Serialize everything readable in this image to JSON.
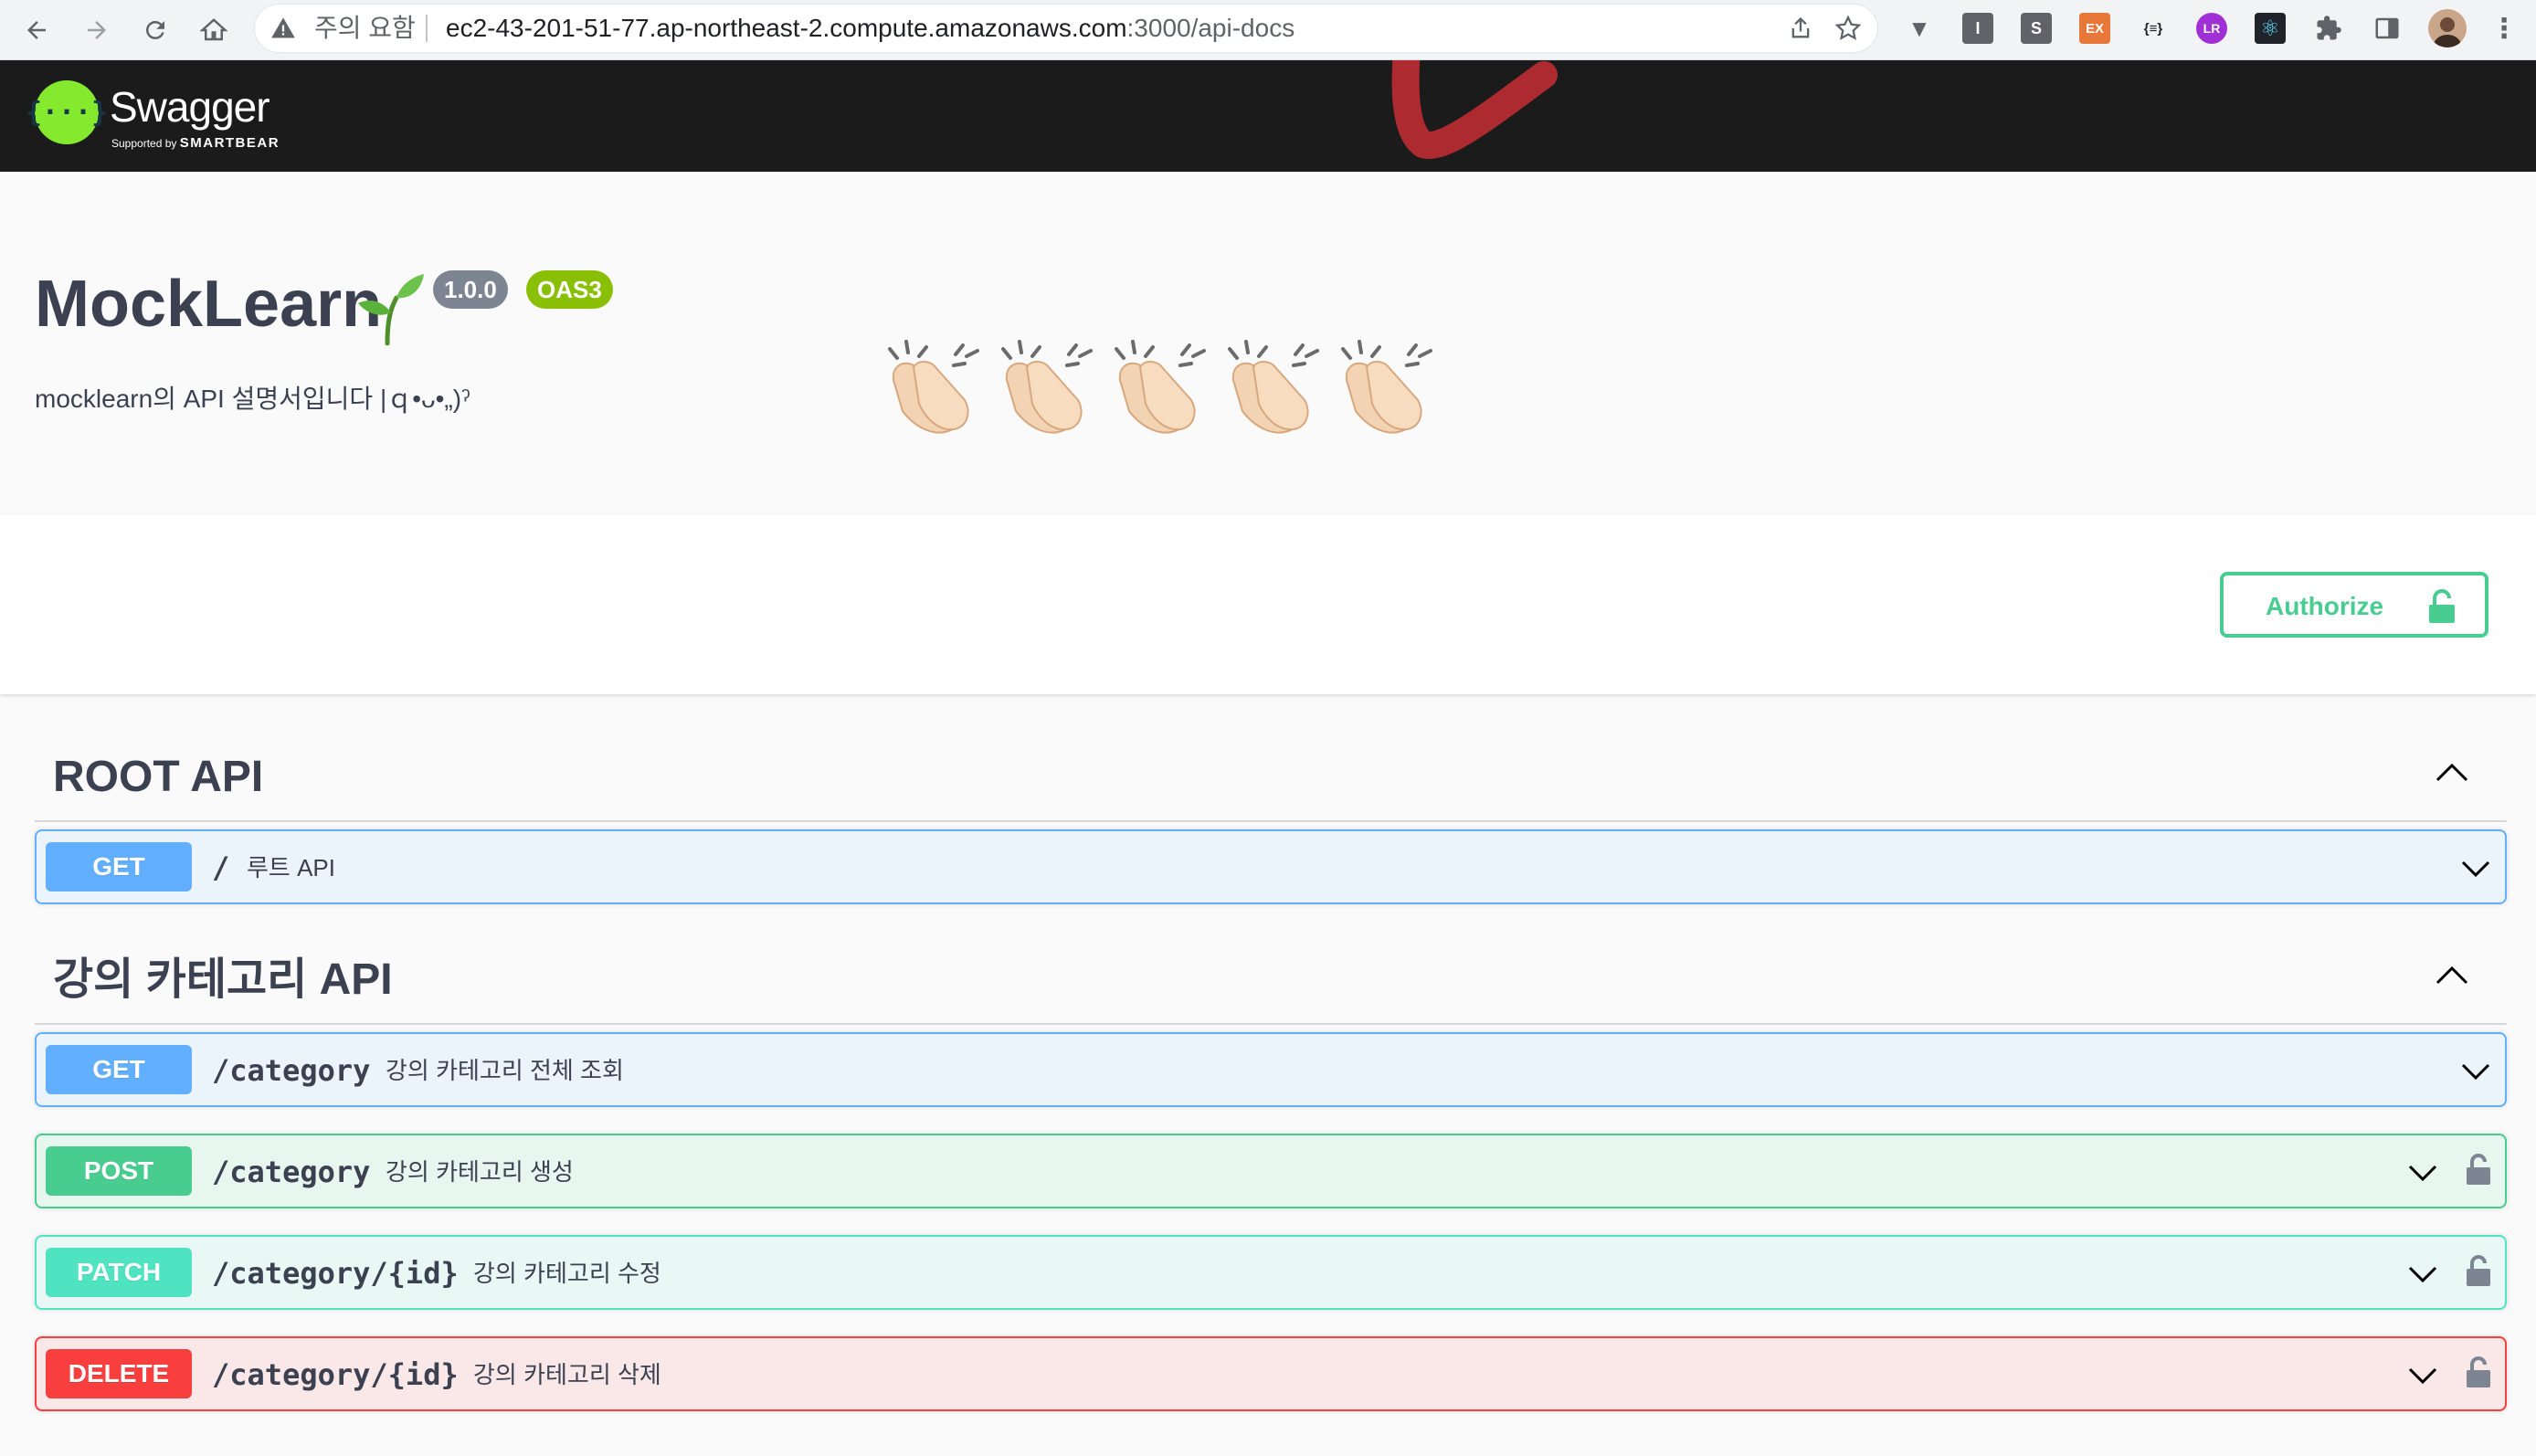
{
  "browser": {
    "security_label": "주의 요함",
    "url_host": "ec2-43-201-51-77.ap-northeast-2.compute.amazonaws.com",
    "url_rest": ":3000/api-docs",
    "extensions": [
      {
        "name": "vue-devtools-icon",
        "glyph": "V",
        "color": "#5f6368"
      },
      {
        "name": "i-extension-icon",
        "glyph": "I",
        "color": "#5f6368"
      },
      {
        "name": "s-extension-icon",
        "glyph": "S",
        "color": "#5f6368"
      },
      {
        "name": "ex-extension-icon",
        "glyph": "EX",
        "color": "#e8773a"
      },
      {
        "name": "json-viewer-icon",
        "glyph": "{≡}",
        "color": "#202124"
      },
      {
        "name": "lr-extension-icon",
        "glyph": "LR",
        "color": "#a02fd6"
      },
      {
        "name": "react-devtools-icon",
        "glyph": "⚛",
        "color": "#20232a"
      }
    ]
  },
  "topbar": {
    "logo_glyph": "{···}",
    "logo_text": "Swagger",
    "supported_by": "Supported by",
    "smartbear": "SMARTBEAR"
  },
  "info": {
    "title": "MockLearn",
    "version": "1.0.0",
    "oas": "OAS3",
    "description": "mocklearn의 API 설명서입니다 |ｑ•ᴗ•„)ˀ",
    "emoji": "👏🏻👏🏻👏🏻👏🏻👏🏻"
  },
  "authorize_label": "Authorize",
  "tags": [
    {
      "name": "ROOT API",
      "operations": [
        {
          "method": "GET",
          "path": "/",
          "summary": "루트 API",
          "locked": false
        }
      ]
    },
    {
      "name": "강의 카테고리 API",
      "operations": [
        {
          "method": "GET",
          "path": "/category",
          "summary": "강의 카테고리 전체 조회",
          "locked": false
        },
        {
          "method": "POST",
          "path": "/category",
          "summary": "강의 카테고리 생성",
          "locked": true
        },
        {
          "method": "PATCH",
          "path": "/category/{id}",
          "summary": "강의 카테고리 수정",
          "locked": true
        },
        {
          "method": "DELETE",
          "path": "/category/{id}",
          "summary": "강의 카테고리 삭제",
          "locked": true
        }
      ]
    }
  ],
  "colors": {
    "get": "#61affe",
    "post": "#49cc90",
    "patch": "#50e3c2",
    "delete": "#f93e3e",
    "swagger_green": "#85ea2d",
    "topbar": "#1b1b1b"
  }
}
